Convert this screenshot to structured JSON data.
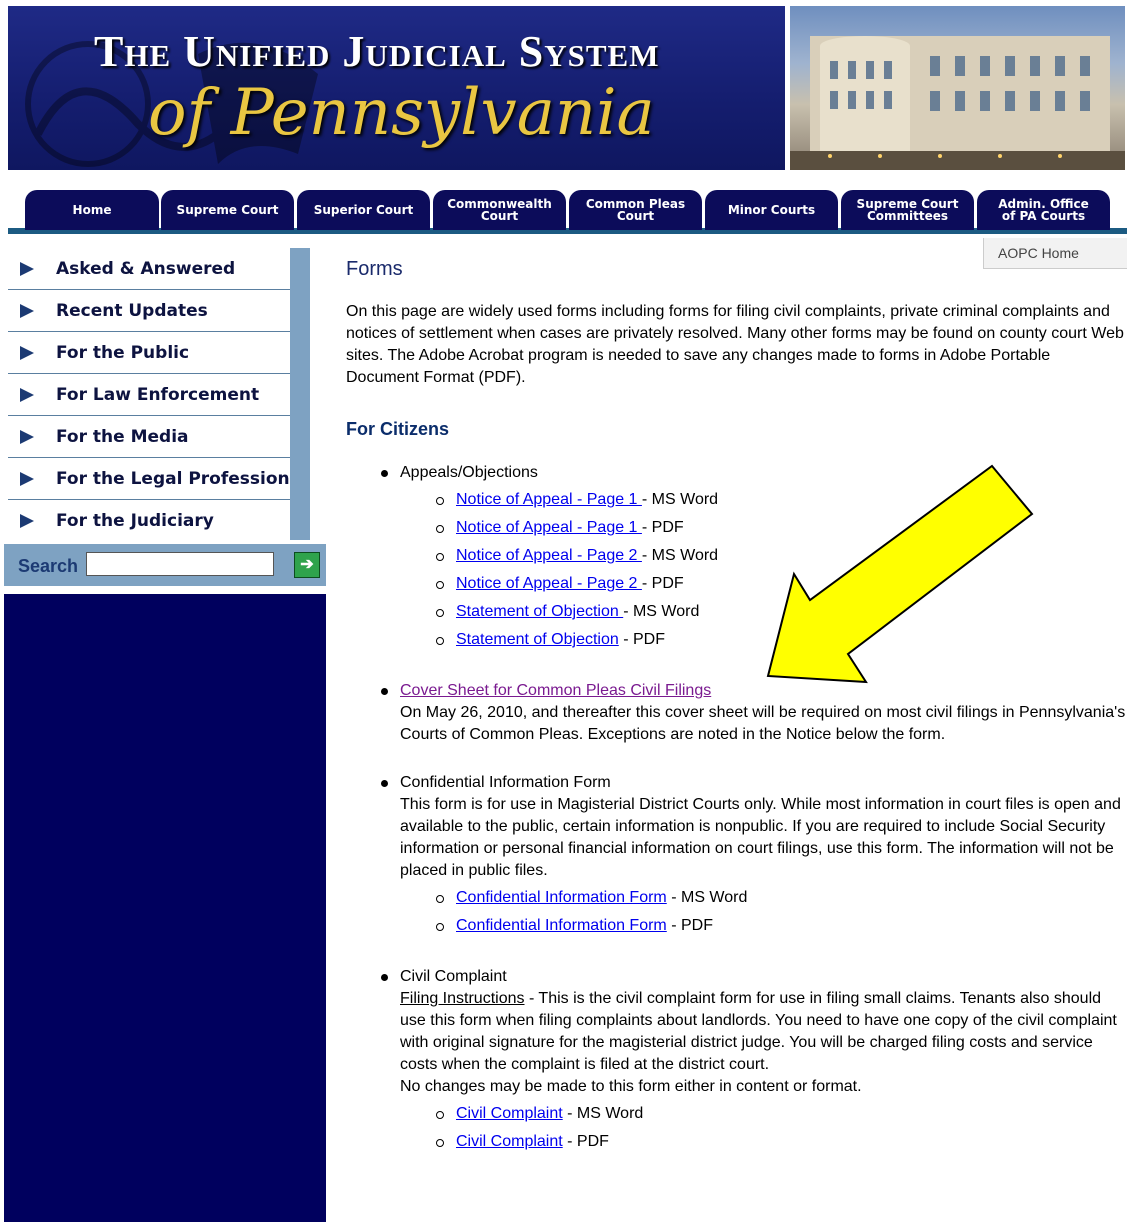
{
  "header": {
    "title_line1": "The Unified Judicial System",
    "title_line2": "of Pennsylvania"
  },
  "nav": {
    "tabs": [
      {
        "label": "Home"
      },
      {
        "label": "Supreme Court"
      },
      {
        "label": "Superior Court"
      },
      {
        "label": "Commonwealth Court"
      },
      {
        "label": "Common Pleas Court"
      },
      {
        "label": "Minor Courts"
      },
      {
        "label": "Supreme Court Committees"
      },
      {
        "label": "Admin. Office of PA Courts"
      }
    ]
  },
  "sidebar": {
    "items": [
      {
        "label": "Asked & Answered"
      },
      {
        "label": "Recent Updates"
      },
      {
        "label": "For the Public"
      },
      {
        "label": "For Law Enforcement"
      },
      {
        "label": "For the Media"
      },
      {
        "label": "For the Legal Profession"
      },
      {
        "label": "For the Judiciary"
      }
    ],
    "search_label": "Search",
    "search_value": "",
    "go_icon": "arrow-right-icon"
  },
  "aopc_home": "AOPC Home",
  "page": {
    "title": "Forms",
    "intro": "On this page are widely used forms including forms for filing civil complaints, private criminal complaints and notices of settlement when cases are privately resolved. Many other forms may be found on county court Web sites.  The Adobe Acrobat program is needed to save any changes made to forms in Adobe Portable Document Format (PDF).",
    "section_heading": "For Citizens",
    "appeals": {
      "label": "Appeals/Objections",
      "items": [
        {
          "link": "Notice of Appeal - Page 1 ",
          "suffix": " - MS Word"
        },
        {
          "link": "Notice of Appeal - Page 1 ",
          "suffix": " - PDF"
        },
        {
          "link": "Notice of Appeal - Page 2 ",
          "suffix": " - MS Word"
        },
        {
          "link": "Notice of Appeal - Page 2 ",
          "suffix": " - PDF"
        },
        {
          "link": "Statement of Objection ",
          "suffix": " - MS Word"
        },
        {
          "link": "Statement of Objection",
          "suffix": "  - PDF"
        }
      ]
    },
    "cover_sheet": {
      "link": "Cover Sheet for Common Pleas Civil Filings",
      "desc": "On May 26, 2010, and thereafter this cover sheet will be required on most civil filings in Pennsylvania's Courts of Common Pleas. Exceptions are noted in the Notice below the form."
    },
    "confidential": {
      "label": "Confidential Information Form",
      "desc": "This form is for use in Magisterial District Courts only. While most information in court files is open and available to the public, certain information is nonpublic. If you are required to include Social Security information or personal financial information on court filings, use this form. The information will not be placed in public files.",
      "items": [
        {
          "link": "Confidential Information Form",
          "suffix": " - MS Word"
        },
        {
          "link": "Confidential Information Form",
          "suffix": " - PDF"
        }
      ]
    },
    "civil_complaint": {
      "label": "Civil Complaint",
      "instructions_label": "Filing Instructions",
      "desc": " - This is the civil complaint form for use in filing small claims. Tenants also should use this form when filing complaints about landlords. You need to have one copy of the civil complaint with original signature for the magisterial district judge. You will be charged filing costs and service costs when the complaint is filed at the district court.",
      "note": "No changes may be made to this form either in content or format.",
      "items": [
        {
          "link": "Civil Complaint",
          "suffix": "  - MS Word"
        },
        {
          "link": "Civil Complaint",
          "suffix": "  - PDF"
        }
      ]
    }
  },
  "annotation": {
    "arrow_color": "#ffff00"
  }
}
